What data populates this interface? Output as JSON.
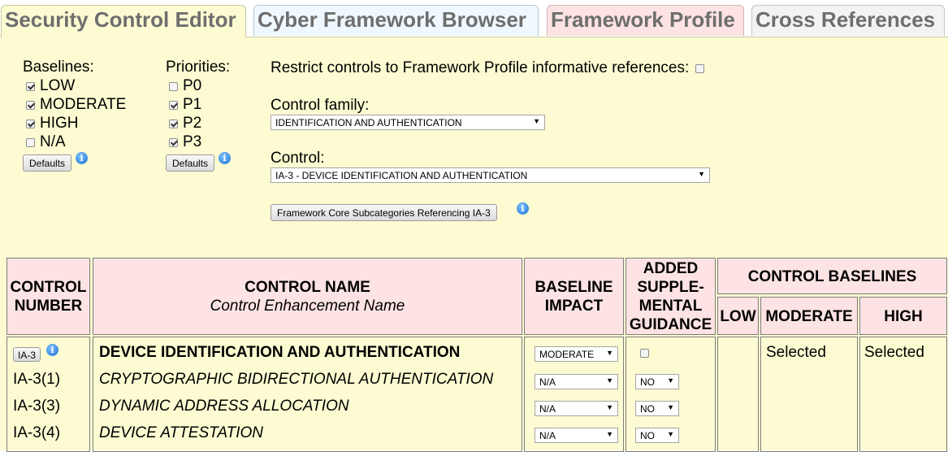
{
  "tabs": [
    {
      "label": "Security Control Editor"
    },
    {
      "label": "Cyber Framework Browser"
    },
    {
      "label": "Framework Profile"
    },
    {
      "label": "Cross References"
    }
  ],
  "baselines": {
    "heading": "Baselines:",
    "items": [
      {
        "label": "LOW",
        "checked": true
      },
      {
        "label": "MODERATE",
        "checked": true
      },
      {
        "label": "HIGH",
        "checked": true
      },
      {
        "label": "N/A",
        "checked": false
      }
    ],
    "defaults_label": "Defaults"
  },
  "priorities": {
    "heading": "Priorities:",
    "items": [
      {
        "label": "P0",
        "checked": false
      },
      {
        "label": "P1",
        "checked": true
      },
      {
        "label": "P2",
        "checked": true
      },
      {
        "label": "P3",
        "checked": true
      }
    ],
    "defaults_label": "Defaults"
  },
  "restrict": {
    "label": "Restrict controls to Framework Profile informative references:",
    "checked": false
  },
  "control_family": {
    "label": "Control family:",
    "value": "IDENTIFICATION AND AUTHENTICATION"
  },
  "control": {
    "label": "Control:",
    "value": "IA-3 - DEVICE IDENTIFICATION AND AUTHENTICATION"
  },
  "subcategories_button": "Framework Core Subcategories Referencing IA-3",
  "info_icon": "info-icon",
  "table": {
    "headers": {
      "control_number": [
        "CONTROL",
        "NUMBER"
      ],
      "control_name": "CONTROL NAME",
      "control_enhancement": "Control Enhancement Name",
      "baseline_impact": [
        "BASELINE",
        "IMPACT"
      ],
      "added_guidance": [
        "ADDED",
        "SUPPLE-",
        "MENTAL",
        "GUIDANCE"
      ],
      "control_baselines": "CONTROL BASELINES",
      "low": "LOW",
      "moderate": "MODERATE",
      "high": "HIGH"
    },
    "rows": [
      {
        "number": "IA-3",
        "name": "DEVICE IDENTIFICATION AND AUTHENTICATION",
        "impact": "MODERATE",
        "guidance": null
      },
      {
        "number": "IA-3(1)",
        "name": "CRYPTOGRAPHIC BIDIRECTIONAL AUTHENTICATION",
        "impact": "N/A",
        "guidance": "NO"
      },
      {
        "number": "IA-3(3)",
        "name": "DYNAMIC ADDRESS ALLOCATION",
        "impact": "N/A",
        "guidance": "NO"
      },
      {
        "number": "IA-3(4)",
        "name": "DEVICE ATTESTATION",
        "impact": "N/A",
        "guidance": "NO"
      }
    ],
    "baseline_values": {
      "low": "",
      "moderate": "Selected",
      "high": "Selected"
    }
  }
}
